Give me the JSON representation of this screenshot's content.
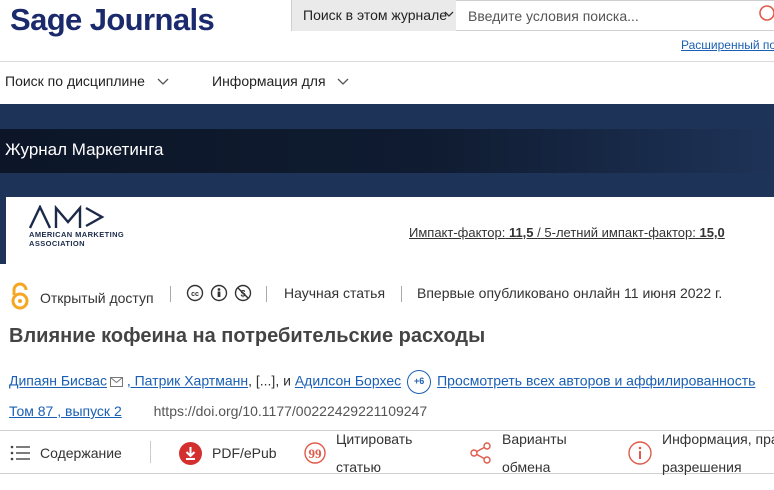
{
  "header": {
    "logo": "Sage Journals",
    "search_scope": "Поиск в этом журнале",
    "search_placeholder": "Введите условия поиска...",
    "advanced_search": "Расширенный по"
  },
  "nav": {
    "items": [
      {
        "label": "Поиск по дисциплине"
      },
      {
        "label": "Информация для"
      }
    ]
  },
  "journal": {
    "title": "Журнал Маркетинга",
    "publisher_sub_line1": "AMERICAN MARKETING",
    "publisher_sub_line2": "ASSOCIATION",
    "impact_label": "Импакт-фактор:",
    "impact_value": "11,5",
    "impact_sep": "/",
    "impact5_label": "5-летний импакт-фактор:",
    "impact5_value": "15,0"
  },
  "article": {
    "access": "Открытый доступ",
    "type": "Научная статья",
    "published": "Впервые опубликовано онлайн 11 июня 2022 г.",
    "title": "Влияние кофеина на потребительские расходы",
    "authors": {
      "first": "Дипаян Бисвас",
      "second": ", Патрик Хартманн",
      "ellipsis": ", [...], и ",
      "third": "Адилсон Борхес",
      "more_count": "+6",
      "view_all": "Просмотреть всех авторов и аффилированность"
    },
    "volume": "Том 87 , выпуск 2",
    "doi": "https://doi.org/10.1177/00222429221109247"
  },
  "toolbar": {
    "contents": "Содержание",
    "pdf": "PDF/ePub",
    "cite_line1": "Цитировать",
    "cite_line2": "статью",
    "share_line1": "Варианты",
    "share_line2": "обмена",
    "info_line1": "Информация, пра",
    "info_line2": "разрешения"
  },
  "colors": {
    "brand": "#1a2a6c",
    "banner": "#1e3358",
    "link": "#1a5fb4",
    "open_access": "#f5a623",
    "pdf": "#d32f2f",
    "tool_icon": "#e05a4a"
  }
}
